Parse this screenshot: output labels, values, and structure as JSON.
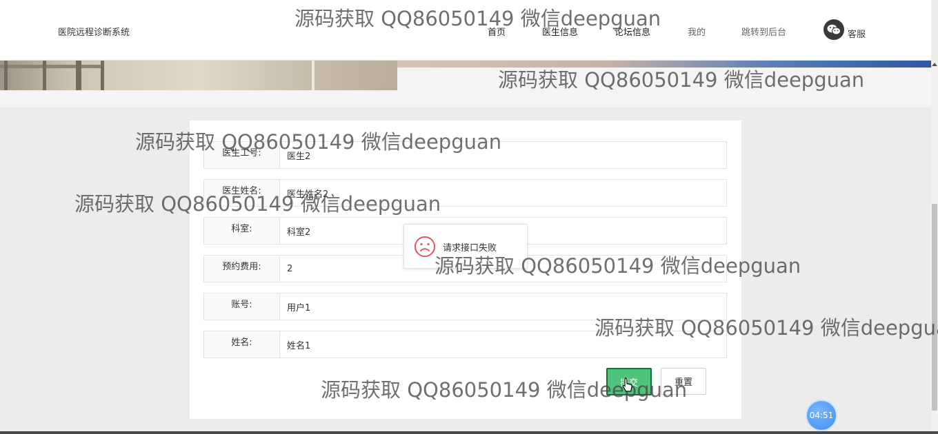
{
  "header": {
    "site_title": "医院远程诊断系统",
    "nav": [
      "首页",
      "医生信息",
      "论坛信息",
      "我的",
      "跳转到后台"
    ],
    "service_label": "客服"
  },
  "form": {
    "fields": [
      {
        "label": "医生工号:",
        "value": "医生2"
      },
      {
        "label": "医生姓名:",
        "value": "医生姓名2"
      },
      {
        "label": "科室:",
        "value": "科室2"
      },
      {
        "label": "预约费用:",
        "value": "2"
      },
      {
        "label": "账号:",
        "value": "用户1"
      },
      {
        "label": "姓名:",
        "value": "姓名1"
      }
    ],
    "submit_label": "提交",
    "reset_label": "重置"
  },
  "toast": {
    "icon": "sad-face-icon",
    "message": "请求接口失败"
  },
  "timer": "04:51",
  "watermark": "源码获取 QQ86050149 微信deepguan",
  "colors": {
    "submit": "#4ec37c",
    "toast_icon": "#e05a5a",
    "timer": "#3f8ef0"
  }
}
